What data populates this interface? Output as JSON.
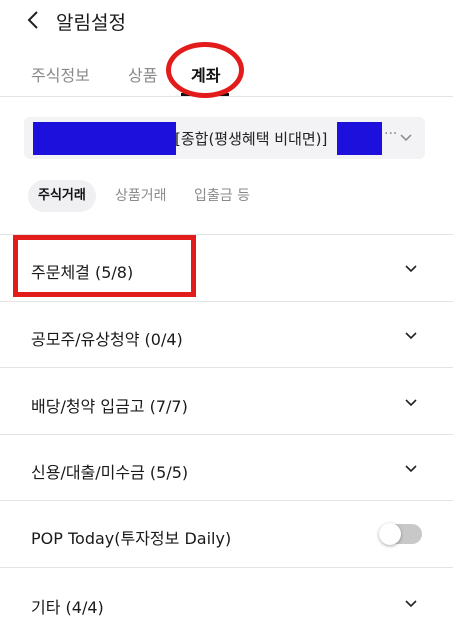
{
  "header": {
    "title": "알림설정"
  },
  "tabs": [
    {
      "label": "주식정보"
    },
    {
      "label": "상품"
    },
    {
      "label": "계좌"
    }
  ],
  "account": {
    "name": "[종합(평생혜택 비대면)]"
  },
  "subtabs": [
    {
      "label": "주식거래"
    },
    {
      "label": "상품거래"
    },
    {
      "label": "입출금 등"
    }
  ],
  "rows": [
    {
      "label": "주문체결 (5/8)"
    },
    {
      "label": "공모주/유상청약 (0/4)"
    },
    {
      "label": "배당/청약 입금고 (7/7)"
    },
    {
      "label": "신용/대출/미수금 (5/5)"
    },
    {
      "label": "POP Today(투자정보 Daily)",
      "toggle_on": false
    },
    {
      "label": "기타 (4/4)"
    }
  ],
  "colors": {
    "highlight": "#e21b1b",
    "redaction": "#1d10dc"
  }
}
